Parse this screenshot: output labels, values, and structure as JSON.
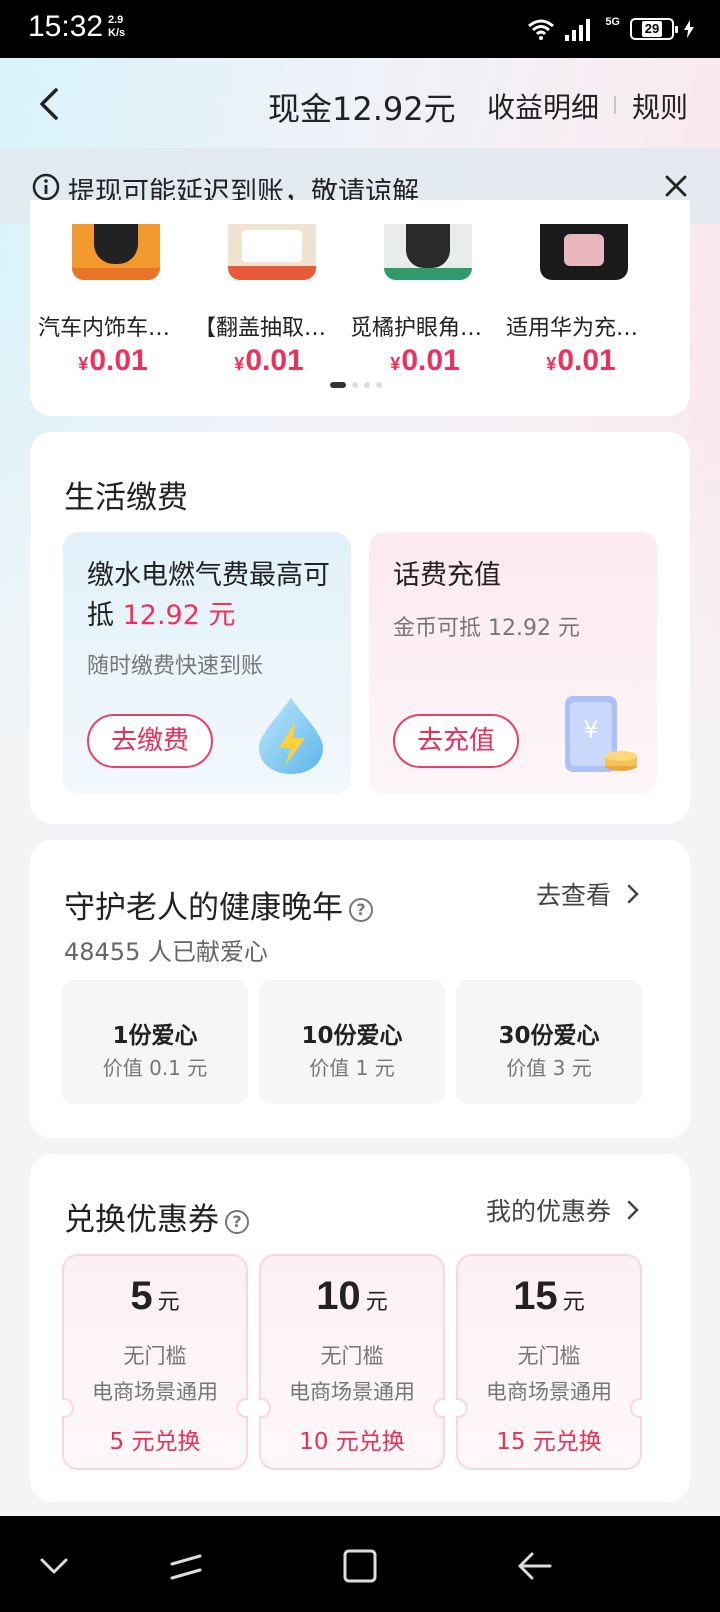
{
  "status_bar": {
    "time": "15:32",
    "speed_value": "2.9",
    "speed_unit": "K/s",
    "network": "5G",
    "battery": "29"
  },
  "header": {
    "cash": "现金12.92元",
    "income_detail": "收益明细",
    "rules": "规则"
  },
  "notice": {
    "text": "提现可能延迟到账，敬请谅解"
  },
  "products": [
    {
      "name": "汽车内饰车内...",
      "price": "0.01",
      "currency": "¥"
    },
    {
      "name": "【翻盖抽取】...",
      "price": "0.01",
      "currency": "¥"
    },
    {
      "name": "觅橘护眼角口...",
      "price": "0.01",
      "currency": "¥"
    },
    {
      "name": "适用华为充电...",
      "price": "0.01",
      "currency": "¥"
    }
  ],
  "life": {
    "title": "生活缴费",
    "water": {
      "title_prefix": "缴水电燃气费最高可抵 ",
      "amount": "12.92 元",
      "subtitle": "随时缴费快速到账",
      "button": "去缴费"
    },
    "phone": {
      "title": "话费充值",
      "subtitle": "金币可抵 12.92 元",
      "button": "去充值"
    }
  },
  "charity": {
    "title": "守护老人的健康晚年",
    "count": "48455 人已献爱心",
    "more": "去查看",
    "options": [
      {
        "label": "1份爱心",
        "value": "价值 0.1 元"
      },
      {
        "label": "10份爱心",
        "value": "价值 1 元"
      },
      {
        "label": "30份爱心",
        "value": "价值 3 元"
      }
    ]
  },
  "coupons": {
    "title": "兑换优惠券",
    "my_coupons": "我的优惠券",
    "items": [
      {
        "amount": "5",
        "unit": "元",
        "threshold": "无门槛",
        "scope": "电商场景通用",
        "action": "5 元兑换"
      },
      {
        "amount": "10",
        "unit": "元",
        "threshold": "无门槛",
        "scope": "电商场景通用",
        "action": "10 元兑换"
      },
      {
        "amount": "15",
        "unit": "元",
        "threshold": "无门槛",
        "scope": "电商场景通用",
        "action": "15 元兑换"
      }
    ]
  },
  "colors": {
    "accent_red": "#f0305a",
    "bill_blue": "#e2f1fa",
    "bill_pink": "#fde9ee"
  }
}
